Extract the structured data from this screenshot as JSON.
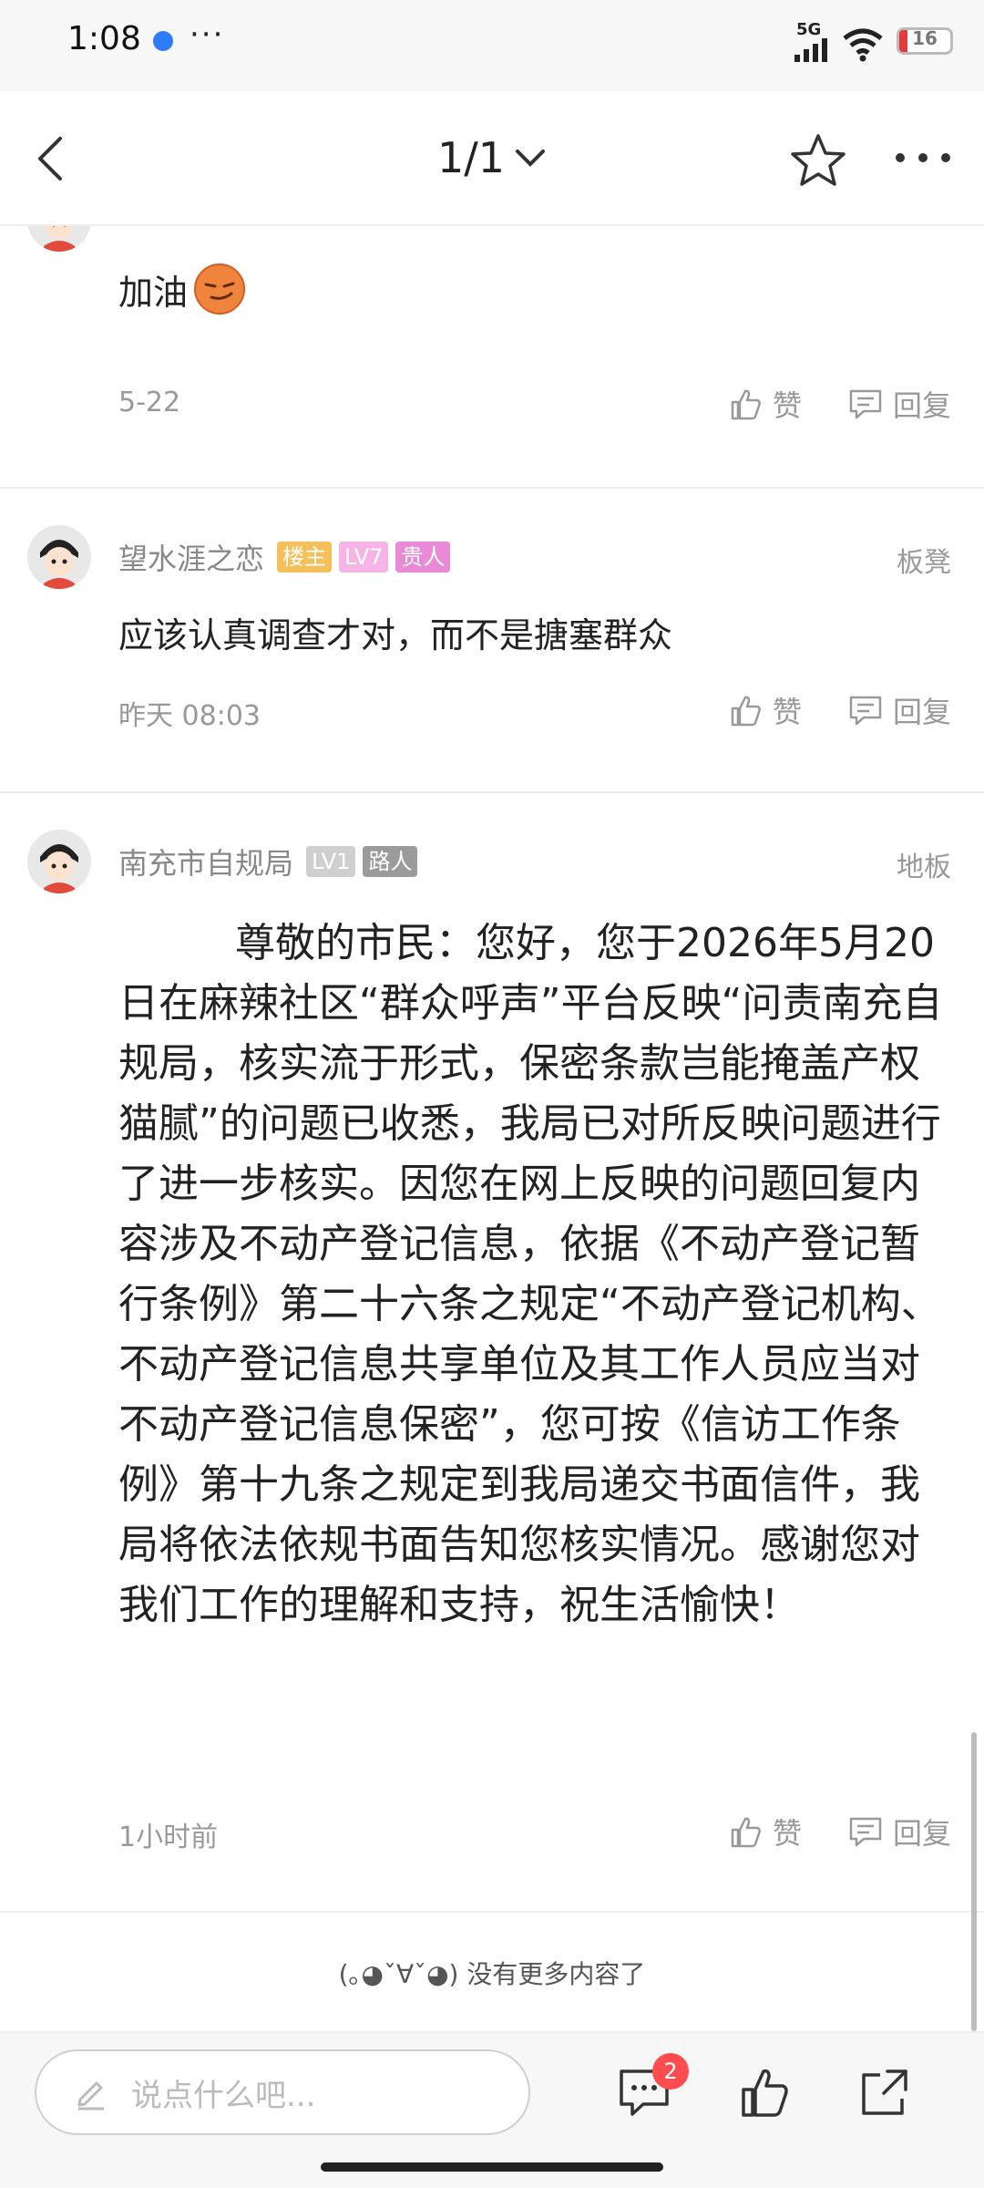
{
  "status_bar": {
    "time": "1:08",
    "more": "···",
    "network": "5G",
    "battery": "16",
    "battery_level": 0.16
  },
  "nav": {
    "page_indicator": "1/1"
  },
  "comments": [
    {
      "text": "加油",
      "emoji": "smirk-emoji",
      "time": "5-22",
      "like_label": "赞",
      "reply_label": "回复"
    },
    {
      "username": "望水涯之恋",
      "badges": [
        "楼主",
        "LV7",
        "贵人"
      ],
      "floor": "板凳",
      "text": "应该认真调查才对，而不是搪塞群众",
      "time": "昨天 08:03",
      "like_label": "赞",
      "reply_label": "回复"
    },
    {
      "username": "南充市自规局",
      "badges": [
        "LV1",
        "路人"
      ],
      "floor": "地板",
      "text": "尊敬的市民：您好，您于2026年5月20日在麻辣社区“群众呼声”平台反映“问责南充自规局，核实流于形式，保密条款岂能掩盖产权猫腻”的问题已收悉，我局已对所反映问题进行了进一步核实。因您在网上反映的问题回复内容涉及不动产登记信息，依据《不动产登记暂行条例》第二十六条之规定“不动产登记机构、不动产登记信息共享单位及其工作人员应当对不动产登记信息保密”，您可按《信访工作条例》第十九条之规定到我局递交书面信件，我局将依法依规书面告知您核实情况。感谢您对我们工作的理解和支持，祝生活愉快！",
      "time": "1小时前",
      "like_label": "赞",
      "reply_label": "回复"
    }
  ],
  "end_note": "(｡◕ˇ∀ˇ◕) 没有更多内容了",
  "bottom_bar": {
    "input_placeholder": "说点什么吧...",
    "comment_count": "2"
  },
  "colors": {
    "badge_host": "#f5c05a",
    "badge_lv7": "#f6b3e6",
    "badge_noble": "#e88ad6",
    "badge_lv1": "#cfcfcf",
    "badge_guest": "#9b9b9b",
    "notification_red": "#ff4d4f"
  }
}
